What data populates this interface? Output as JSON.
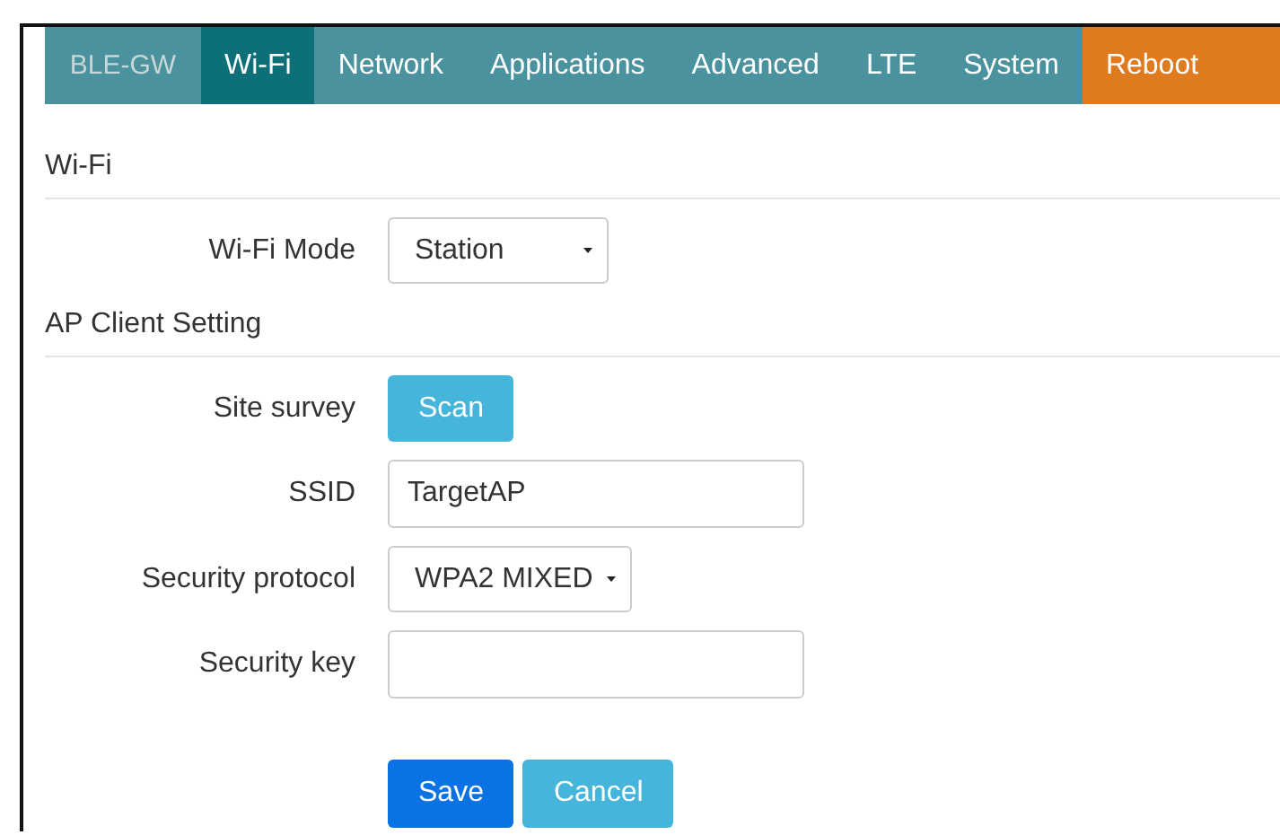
{
  "nav": [
    {
      "label": "BLE-GW",
      "kind": "brand",
      "selected": false
    },
    {
      "label": "Wi-Fi",
      "kind": "tab",
      "selected": true
    },
    {
      "label": "Network",
      "kind": "tab",
      "selected": false
    },
    {
      "label": "Applications",
      "kind": "tab",
      "selected": false
    },
    {
      "label": "Advanced",
      "kind": "tab",
      "selected": false
    },
    {
      "label": "LTE",
      "kind": "tab",
      "selected": false
    },
    {
      "label": "System",
      "kind": "tab",
      "selected": false
    },
    {
      "label": "Reboot",
      "kind": "danger",
      "selected": false
    }
  ],
  "sections": [
    {
      "title": "Wi-Fi",
      "fields": [
        {
          "label": "Wi-Fi Mode",
          "kind": "select",
          "value": "Station"
        }
      ]
    },
    {
      "title": "AP Client Setting",
      "fields": [
        {
          "label": "Site survey",
          "kind": "button",
          "button": "Scan"
        },
        {
          "label": "SSID",
          "kind": "input",
          "value": "TargetAP"
        },
        {
          "label": "Security protocol",
          "kind": "select",
          "value": "WPA2 MIXED"
        },
        {
          "label": "Security key",
          "kind": "input"
        }
      ]
    }
  ],
  "buttons": [
    {
      "label": "Save",
      "kind": "primary"
    },
    {
      "label": "Cancel",
      "kind": "secondary"
    }
  ]
}
